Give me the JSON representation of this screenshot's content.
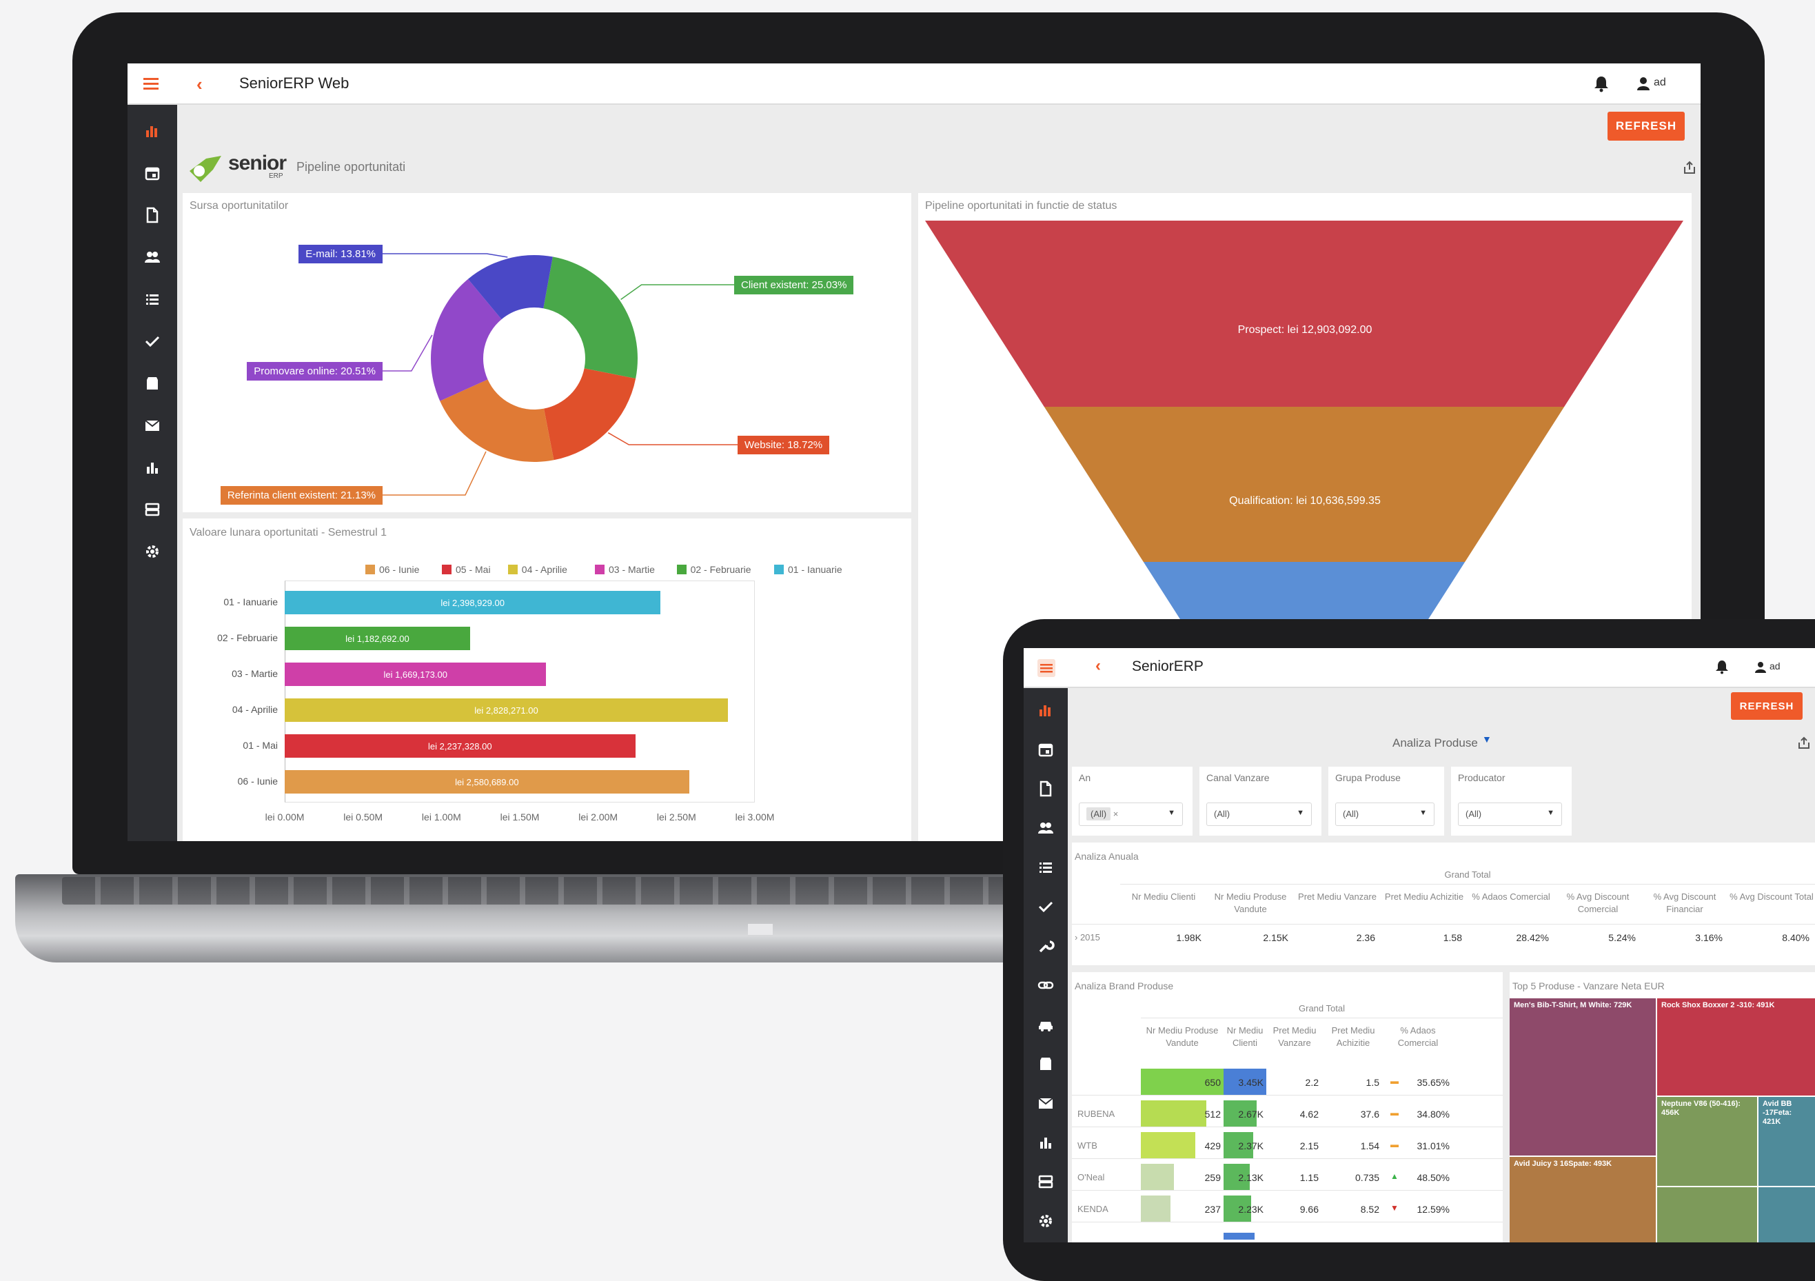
{
  "laptop": {
    "app_title": "SeniorERP Web",
    "user": "ad",
    "refresh_label": "REFRESH",
    "logo_word": "senior",
    "logo_sub": "ERP",
    "page_title": "Pipeline oportunitati",
    "sidebar_icons": [
      "dashboard-icon",
      "calendar-icon",
      "document-icon",
      "users-icon",
      "list-icon",
      "check-icon",
      "inventory-icon",
      "mail-icon",
      "bar-chart-icon",
      "server-icon",
      "gear-icon"
    ],
    "donut_panel_title": "Sursa oportunitatilor",
    "funnel_panel_title": "Pipeline oportunitati in functie de status",
    "bar_panel_title": "Valoare lunara oportunitati - Semestrul 1"
  },
  "tablet": {
    "app_title": "SeniorERP",
    "user": "ad",
    "refresh_label": "REFRESH",
    "page_title": "Analiza Produse",
    "filters": [
      {
        "label": "An",
        "value": "(All)",
        "chip": true
      },
      {
        "label": "Canal Vanzare",
        "value": "(All)",
        "chip": false
      },
      {
        "label": "Grupa Produse",
        "value": "(All)",
        "chip": false
      },
      {
        "label": "Producator",
        "value": "(All)",
        "chip": false
      }
    ],
    "annual": {
      "section_title": "Analiza Anuala",
      "group_header": "Grand Total",
      "columns": [
        "Nr Mediu Clienti",
        "Nr Mediu Produse Vandute",
        "Pret Mediu Vanzare",
        "Pret Mediu Achizitie",
        "% Adaos Comercial",
        "% Avg Discount Comercial",
        "% Avg Discount Financiar",
        "% Avg Discount Total"
      ],
      "row_label": "2015",
      "row_values": [
        "1.98K",
        "2.15K",
        "2.36",
        "1.58",
        "28.42%",
        "5.24%",
        "3.16%",
        "8.40%"
      ]
    },
    "brand": {
      "section_title": "Analiza Brand Produse",
      "group_header": "Grand Total",
      "columns": [
        "Nr Mediu Produse Vandute",
        "Nr Mediu Clienti",
        "Pret Mediu Vanzare",
        "Pret Mediu Achizitie",
        "% Adaos Comercial"
      ],
      "rows": [
        {
          "brand": "",
          "produse": "650",
          "clienti": "3.45K",
          "vanzare": "2.2",
          "achizitie": "1.5",
          "trend": "flat",
          "adaos": "35.65%",
          "produse_fill": 1.0,
          "clienti_fill": 1.0
        },
        {
          "brand": "RUBENA",
          "produse": "512",
          "clienti": "2.67K",
          "vanzare": "4.62",
          "achizitie": "37.6",
          "trend": "flat",
          "adaos": "34.80%",
          "produse_fill": 0.79,
          "clienti_fill": 0.77
        },
        {
          "brand": "WTB",
          "produse": "429",
          "clienti": "2.37K",
          "vanzare": "2.15",
          "achizitie": "1.54",
          "trend": "flat",
          "adaos": "31.01%",
          "produse_fill": 0.66,
          "clienti_fill": 0.69
        },
        {
          "brand": "O'Neal",
          "produse": "259",
          "clienti": "2.13K",
          "vanzare": "1.15",
          "achizitie": "0.735",
          "trend": "up",
          "adaos": "48.50%",
          "produse_fill": 0.4,
          "clienti_fill": 0.62
        },
        {
          "brand": "KENDA",
          "produse": "237",
          "clienti": "2.23K",
          "vanzare": "9.66",
          "achizitie": "8.52",
          "trend": "down",
          "adaos": "12.59%",
          "produse_fill": 0.36,
          "clienti_fill": 0.65
        }
      ]
    },
    "treemap": {
      "section_title": "Top 5 Produse - Vanzare Neta EUR",
      "cells": [
        {
          "label": "Men's Bib-T-Shirt, M White: 729K",
          "color": "#8e4a6a"
        },
        {
          "label": "Rock Shox Boxxer 2 -310: 491K",
          "color": "#c0394a"
        },
        {
          "label": "Neptune V86 (50-416): 456K",
          "color": "#7d9a5a"
        },
        {
          "label": "Avid BB -17Feta: 421K",
          "color": "#4f8b9a"
        },
        {
          "label": "Avid Juicy 3 16Spate: 493K",
          "color": "#b07a44"
        }
      ]
    }
  },
  "chart_data": [
    {
      "type": "pie",
      "title": "Sursa oportunitatilor",
      "categories": [
        "Client existent",
        "Website",
        "Referinta client existent",
        "Promovare online",
        "E-mail"
      ],
      "values": [
        25.03,
        18.72,
        21.13,
        20.51,
        13.81
      ],
      "labels": [
        "Client existent: 25.03%",
        "Website: 18.72%",
        "Referinta client existent: 21.13%",
        "Promovare online: 20.51%",
        "E-mail: 13.81%"
      ],
      "colors": [
        "#49a84a",
        "#e0502b",
        "#e07a35",
        "#9148c9",
        "#4a48c6"
      ]
    },
    {
      "type": "funnel",
      "title": "Pipeline oportunitati in functie de status",
      "categories": [
        "Prospect",
        "Qualification"
      ],
      "values": [
        12903092.0,
        10636599.35
      ],
      "labels": [
        "Prospect: lei 12,903,092.00",
        "Qualification: lei 10,636,599.35"
      ],
      "colors": [
        "#c8414a",
        "#c67f35",
        "#5b8fd6"
      ]
    },
    {
      "type": "bar",
      "orientation": "horizontal",
      "title": "Valoare lunara oportunitati - Semestrul 1",
      "categories": [
        "01 - Ianuarie",
        "02 - Februarie",
        "03 - Martie",
        "04 - Aprilie",
        "01 - Mai",
        "06 - Iunie"
      ],
      "values": [
        2398929.0,
        1182692.0,
        1669173.0,
        2828271.0,
        2237328.0,
        2580689.0
      ],
      "value_labels": [
        "lei 2,398,929.00",
        "lei 1,182,692.00",
        "lei 1,669,173.00",
        "lei 2,828,271.00",
        "lei 2,237,328.00",
        "lei 2,580,689.00"
      ],
      "colors": [
        "#3fb6d3",
        "#49a83e",
        "#cf3fa8",
        "#d6c23a",
        "#d8323a",
        "#e09a4a"
      ],
      "legend": [
        {
          "name": "06 - Iunie",
          "color": "#e09a4a"
        },
        {
          "name": "05 - Mai",
          "color": "#d8323a"
        },
        {
          "name": "04 - Aprilie",
          "color": "#d6c23a"
        },
        {
          "name": "03 - Martie",
          "color": "#cf3fa8"
        },
        {
          "name": "02 - Februarie",
          "color": "#49a83e"
        },
        {
          "name": "01 - Ianuarie",
          "color": "#3fb6d3"
        }
      ],
      "xlim": [
        0,
        3000000
      ],
      "xticks": [
        "lei 0.00M",
        "lei 0.50M",
        "lei 1.00M",
        "lei 1.50M",
        "lei 2.00M",
        "lei 2.50M",
        "lei 3.00M"
      ],
      "legend_position": "top"
    }
  ]
}
